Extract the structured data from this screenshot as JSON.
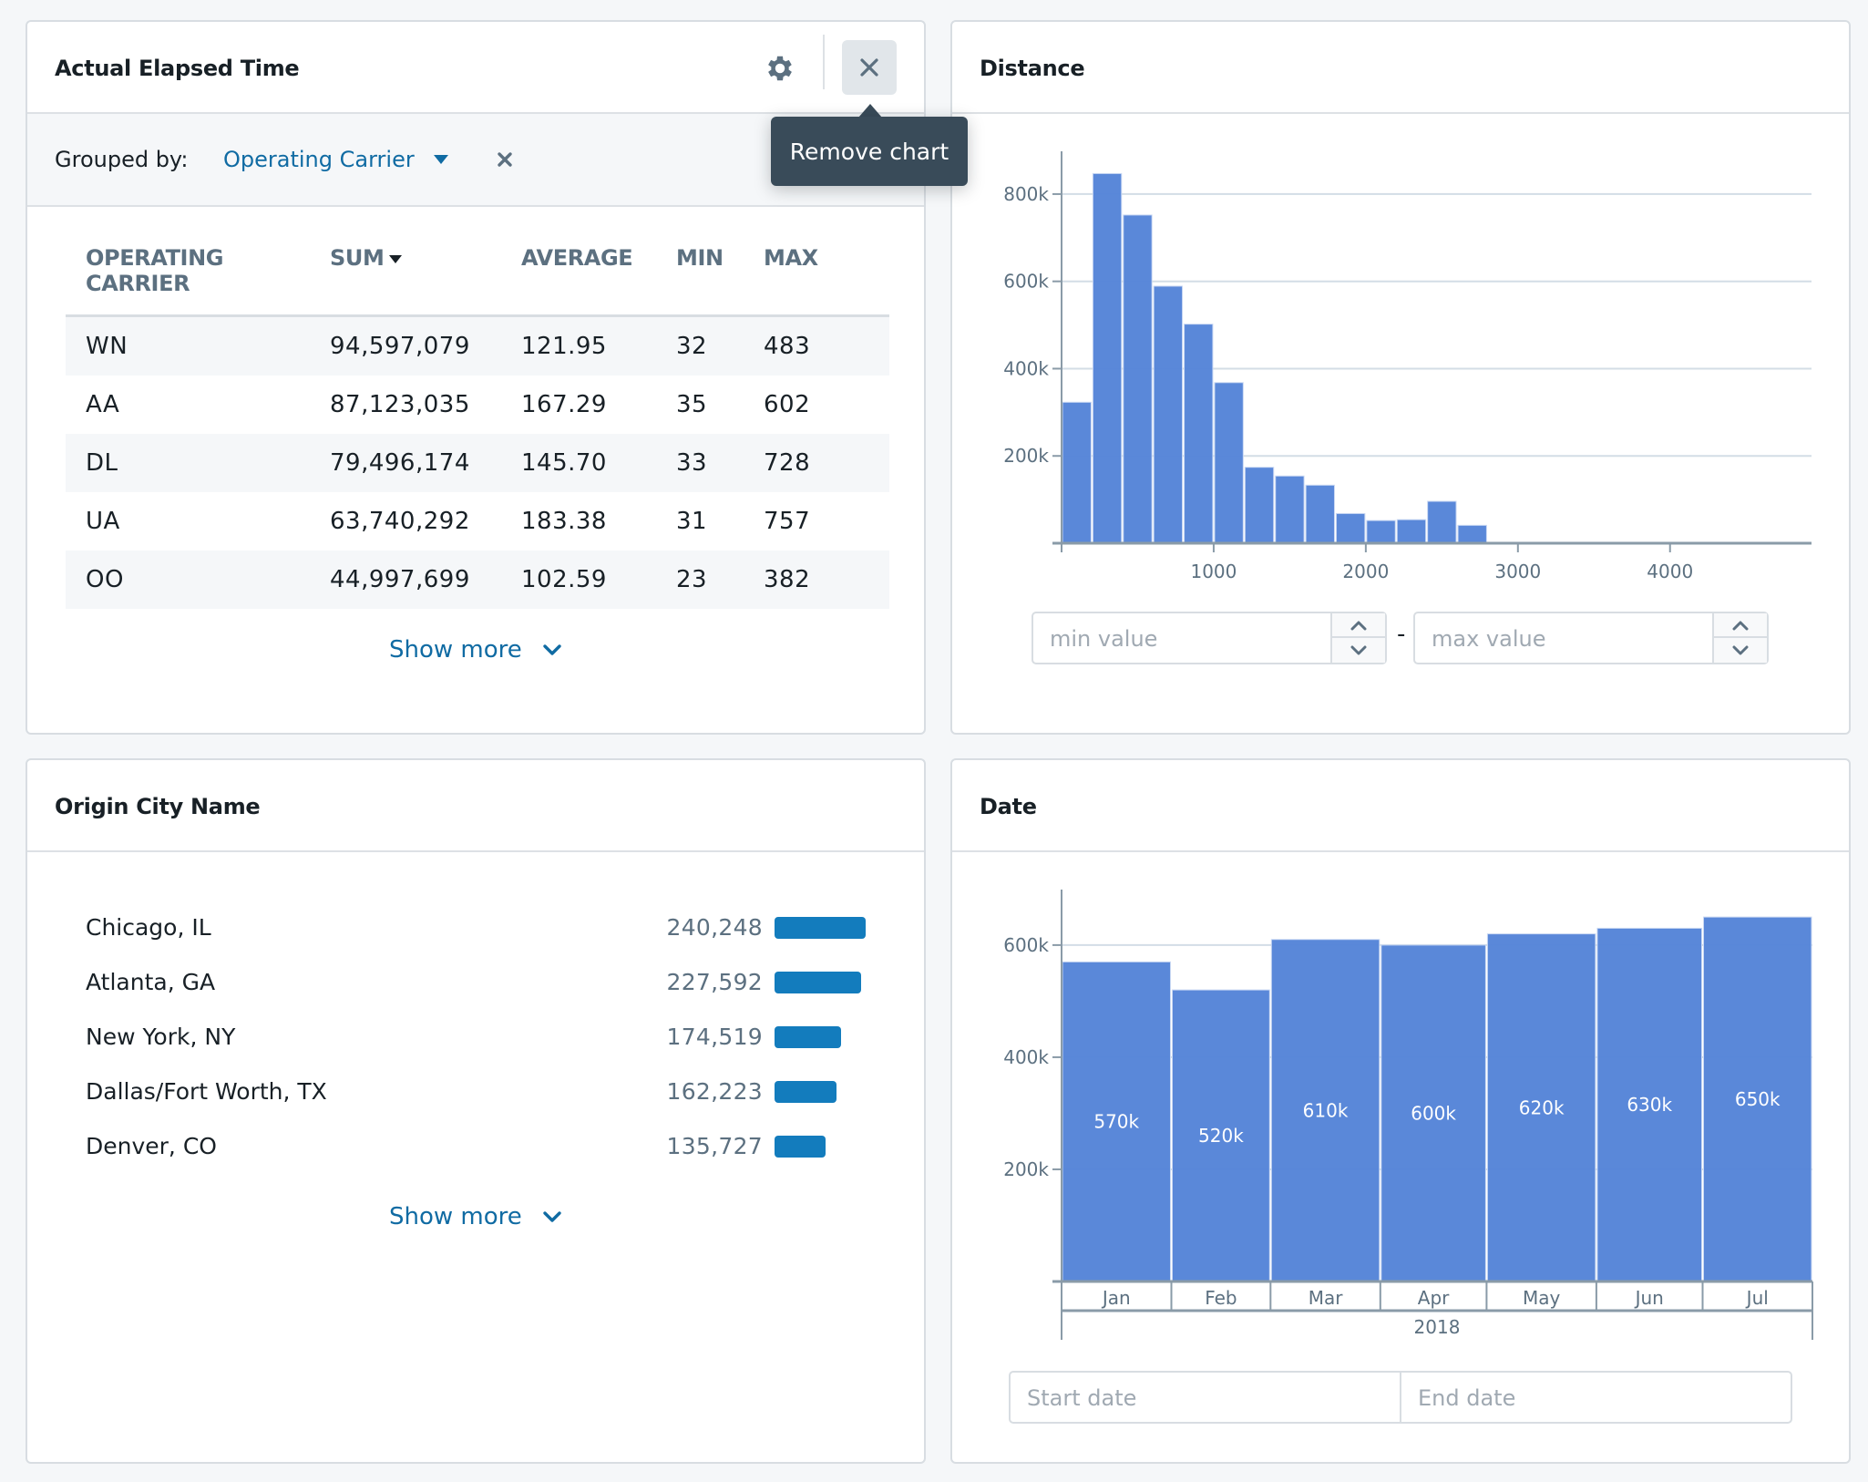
{
  "colors": {
    "background": "#f5f7f9",
    "accent_link": "#106ba3",
    "histogram_bar": "#5584d8",
    "list_bar": "#137cbd",
    "tooltip_bg": "#394b59",
    "muted_text": "#5c7080"
  },
  "panels": {
    "elapsed": {
      "title": "Actual Elapsed Time",
      "settings_icon": "gear-icon",
      "close_icon": "close-icon",
      "tooltip": "Remove chart",
      "grouped_by_label": "Grouped by:",
      "grouped_by_value": "Operating Carrier",
      "table": {
        "columns": [
          "OPERATING CARRIER",
          "SUM",
          "AVERAGE",
          "MIN",
          "MAX"
        ],
        "sorted_column": "SUM",
        "sort_direction": "descending",
        "rows": [
          [
            "WN",
            "94,597,079",
            "121.95",
            "32",
            "483"
          ],
          [
            "AA",
            "87,123,035",
            "167.29",
            "35",
            "602"
          ],
          [
            "DL",
            "79,496,174",
            "145.70",
            "33",
            "728"
          ],
          [
            "UA",
            "63,740,292",
            "183.38",
            "31",
            "757"
          ],
          [
            "OO",
            "44,997,699",
            "102.59",
            "23",
            "382"
          ]
        ]
      },
      "show_more": "Show more"
    },
    "distance": {
      "title": "Distance",
      "min_placeholder": "min value",
      "max_placeholder": "max value",
      "range_separator": "-"
    },
    "origin": {
      "title": "Origin City Name",
      "items": [
        {
          "name": "Chicago, IL",
          "value": "240,248",
          "count": 240248
        },
        {
          "name": "Atlanta, GA",
          "value": "227,592",
          "count": 227592
        },
        {
          "name": "New York, NY",
          "value": "174,519",
          "count": 174519
        },
        {
          "name": "Dallas/Fort Worth, TX",
          "value": "162,223",
          "count": 162223
        },
        {
          "name": "Denver, CO",
          "value": "135,727",
          "count": 135727
        }
      ],
      "show_more": "Show more"
    },
    "date": {
      "title": "Date",
      "start_placeholder": "Start date",
      "end_placeholder": "End date"
    }
  },
  "chart_data": [
    {
      "type": "bar",
      "subtype": "histogram",
      "title": "Distance",
      "xlabel": "",
      "ylabel": "",
      "bin_width": 200,
      "bin_starts": [
        0,
        200,
        400,
        600,
        800,
        1000,
        1200,
        1400,
        1600,
        1800,
        2000,
        2200,
        2400,
        2600,
        2800
      ],
      "values": [
        323000,
        847000,
        752000,
        589000,
        502000,
        368000,
        174000,
        154000,
        133000,
        68000,
        52000,
        54000,
        96000,
        41000,
        2000
      ],
      "xlim": [
        0,
        4930
      ],
      "ylim": [
        0,
        898000
      ],
      "x_ticks": [
        1000,
        2000,
        3000,
        4000
      ],
      "x_tick_labels": [
        "1000",
        "2000",
        "3000",
        "4000"
      ],
      "y_ticks": [
        200000,
        400000,
        600000,
        800000
      ],
      "y_tick_labels": [
        "200k",
        "400k",
        "600k",
        "800k"
      ],
      "grid": "horizontal"
    },
    {
      "type": "bar",
      "subtype": "time-histogram",
      "title": "Date",
      "categories": [
        "Jan",
        "Feb",
        "Mar",
        "Apr",
        "May",
        "Jun",
        "Jul"
      ],
      "days": [
        31,
        28,
        31,
        30,
        31,
        30,
        31
      ],
      "values": [
        570000,
        520000,
        610000,
        600000,
        620000,
        630000,
        650000
      ],
      "data_labels": [
        "570k",
        "520k",
        "610k",
        "600k",
        "620k",
        "630k",
        "650k"
      ],
      "year_label": "2018",
      "ylim": [
        0,
        699000
      ],
      "y_ticks": [
        200000,
        400000,
        600000
      ],
      "y_tick_labels": [
        "200k",
        "400k",
        "600k"
      ],
      "grid": "horizontal"
    }
  ]
}
